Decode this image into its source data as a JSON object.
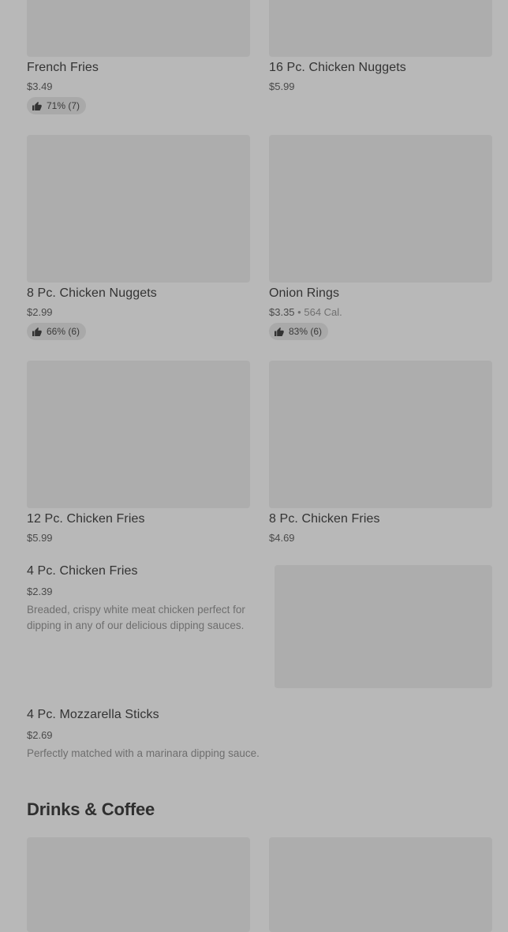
{
  "items": {
    "french_fries": {
      "name": "French Fries",
      "price": "$3.49",
      "rating": "71% (7)"
    },
    "nuggets_16": {
      "name": "16 Pc. Chicken Nuggets",
      "price": "$5.99"
    },
    "nuggets_8": {
      "name": "8 Pc. Chicken Nuggets",
      "price": "$2.99",
      "rating": "66% (6)"
    },
    "onion_rings": {
      "name": "Onion Rings",
      "price": "$3.35",
      "separator": "•",
      "calories": "564 Cal.",
      "rating": "83% (6)"
    },
    "chicken_fries_12": {
      "name": "12 Pc. Chicken Fries",
      "price": "$5.99"
    },
    "chicken_fries_8": {
      "name": "8 Pc. Chicken Fries",
      "price": "$4.69"
    },
    "chicken_fries_4": {
      "name": "4 Pc. Chicken Fries",
      "price": "$2.39",
      "description": "Breaded, crispy white meat chicken perfect for dipping in any of our delicious dipping sauces."
    },
    "mozzarella_sticks": {
      "name": "4 Pc. Mozzarella Sticks",
      "price": "$2.69",
      "description": "Perfectly matched with a marinara dipping sauce."
    }
  },
  "sections": {
    "drinks_title": "Drinks & Coffee"
  },
  "icons": {
    "rating": "thumbs-up-icon"
  },
  "colors": {
    "overlay_background": "#b8b8b8",
    "image_placeholder": "#adadad"
  }
}
